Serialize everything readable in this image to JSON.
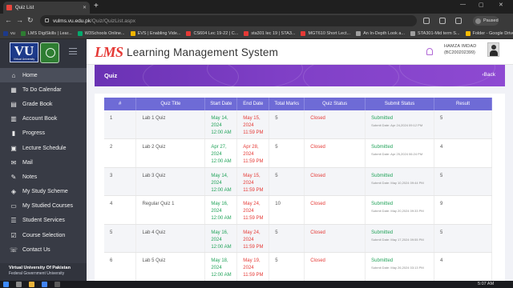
{
  "browser": {
    "tab_title": "Quiz List",
    "url_host": "vulms.vu.edu.pk",
    "url_path": "/Quiz/QuizList.aspx",
    "profile_status": "Paused",
    "bookmarks": [
      {
        "label": "vu",
        "color": "#1d3a8a"
      },
      {
        "label": "LMS DigiSkills | Lear...",
        "color": "#2e7d32"
      },
      {
        "label": "W3Schools Online...",
        "color": "#04aa6d"
      },
      {
        "label": "EVS | Enabling Vide...",
        "color": "#f0b400"
      },
      {
        "label": "CS604 Lec 19-22 | C...",
        "color": "#e53935"
      },
      {
        "label": "sta301 lec 19 | STA3...",
        "color": "#e53935"
      },
      {
        "label": "MGT610 Short Lect...",
        "color": "#e53935"
      },
      {
        "label": "An In-Depth Look a...",
        "color": "#9e9e9e"
      },
      {
        "label": "STA301-Mid term S...",
        "color": "#9e9e9e"
      },
      {
        "label": "Folder - Google Drive",
        "color": "#fbbc04"
      }
    ]
  },
  "sidebar": {
    "logo_text": "VU",
    "logo_caption": "Virtual University",
    "items": [
      {
        "label": "Home",
        "icon": "⌂"
      },
      {
        "label": "To Do Calendar",
        "icon": "▦"
      },
      {
        "label": "Grade Book",
        "icon": "▤"
      },
      {
        "label": "Account Book",
        "icon": "▥"
      },
      {
        "label": "Progress",
        "icon": "▮"
      },
      {
        "label": "Lecture Schedule",
        "icon": "▣"
      },
      {
        "label": "Mail",
        "icon": "✉"
      },
      {
        "label": "Notes",
        "icon": "✎"
      },
      {
        "label": "My Study Scheme",
        "icon": "◈"
      },
      {
        "label": "My Studied Courses",
        "icon": "▭"
      },
      {
        "label": "Student Services",
        "icon": "☰"
      },
      {
        "label": "Course Selection",
        "icon": "☑"
      },
      {
        "label": "Contact Us",
        "icon": "☏"
      }
    ],
    "footer_title": "Virtual University Of Pakistan",
    "footer_sub": "Federal Government University"
  },
  "header": {
    "logo": "LMS",
    "title": "Learning Management System",
    "user_name": "HAMZA IMDAD",
    "user_id": "(BC200202399)"
  },
  "banner": {
    "title": "Quiz",
    "back_label": "Back"
  },
  "table": {
    "headers": [
      "#",
      "Quiz Title",
      "Start Date",
      "End Date",
      "Total Marks",
      "Quiz Status",
      "Submit Status",
      "Result"
    ],
    "rows": [
      {
        "num": "1",
        "title": "Lab 1 Quiz",
        "start_l1": "May 14,",
        "start_l2": "2024",
        "start_l3": "12:00 AM",
        "end_l1": "May 15,",
        "end_l2": "2024",
        "end_l3": "11:59 PM",
        "marks": "5",
        "status": "Closed",
        "submit": "Submitted",
        "submit_date": "Submit Date: Apr 24,2024 09:12 PM",
        "result": "5"
      },
      {
        "num": "2",
        "title": "Lab 2 Quiz",
        "start_l1": "Apr 27,",
        "start_l2": "2024",
        "start_l3": "12:00 AM",
        "end_l1": "Apr 28,",
        "end_l2": "2024",
        "end_l3": "11:59 PM",
        "marks": "5",
        "status": "Closed",
        "submit": "Submitted",
        "submit_date": "Submit Date: Apr 25,2024 06:24 PM",
        "result": "4"
      },
      {
        "num": "3",
        "title": "Lab 3 Quiz",
        "start_l1": "May 14,",
        "start_l2": "2024",
        "start_l3": "12:00 AM",
        "end_l1": "May 15,",
        "end_l2": "2024",
        "end_l3": "11:59 PM",
        "marks": "5",
        "status": "Closed",
        "submit": "Submitted",
        "submit_date": "Submit Date: May 10,2024 09:44 PM",
        "result": "5"
      },
      {
        "num": "4",
        "title": "Regular Quiz 1",
        "start_l1": "May 16,",
        "start_l2": "2024",
        "start_l3": "12:00 AM",
        "end_l1": "May 24,",
        "end_l2": "2024",
        "end_l3": "11:59 PM",
        "marks": "10",
        "status": "Closed",
        "submit": "Submitted",
        "submit_date": "Submit Date: May 20,2024 09:33 PM",
        "result": "9"
      },
      {
        "num": "5",
        "title": "Lab 4 Quiz",
        "start_l1": "May 16,",
        "start_l2": "2024",
        "start_l3": "12:00 AM",
        "end_l1": "May 24,",
        "end_l2": "2024",
        "end_l3": "11:59 PM",
        "marks": "5",
        "status": "Closed",
        "submit": "Submitted",
        "submit_date": "Submit Date: May 17,2024 09:55 PM",
        "result": "5"
      },
      {
        "num": "6",
        "title": "Lab 5 Quiz",
        "start_l1": "May 18,",
        "start_l2": "2024",
        "start_l3": "12:00 AM",
        "end_l1": "May 19,",
        "end_l2": "2024",
        "end_l3": "11:59 PM",
        "marks": "5",
        "status": "Closed",
        "submit": "Submitted",
        "submit_date": "Submit Date: May 26,2024 03:13 PM",
        "result": "4"
      }
    ]
  },
  "taskbar": {
    "clock": "5:07 AM"
  }
}
